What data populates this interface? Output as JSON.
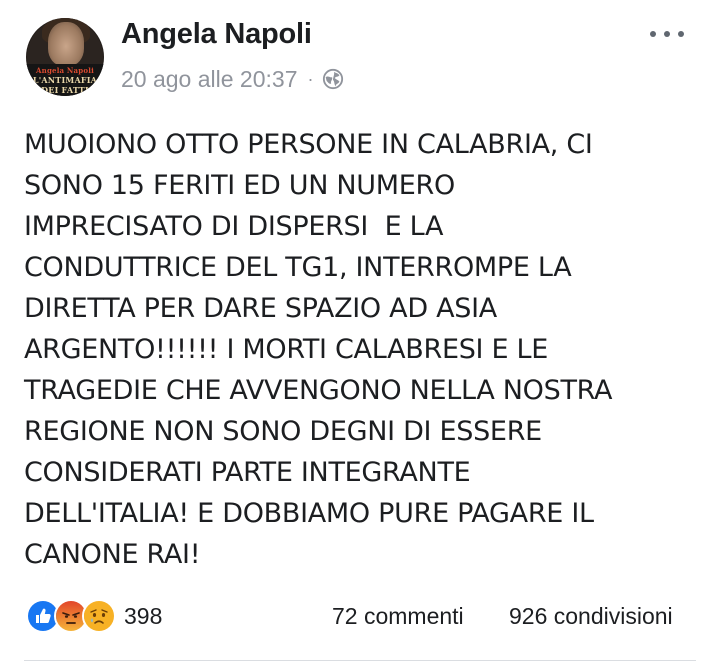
{
  "post": {
    "author": {
      "name": "Angela Napoli",
      "avatar_text": [
        "Angela Napoli",
        "L'ANTIMAFIA",
        "DEI FATTI"
      ]
    },
    "meta": {
      "timestamp": "20 ago alle 20:37",
      "separator": "·",
      "privacy_icon": "globe-icon"
    },
    "menu_icon": "more-horizontal-icon",
    "body_lines": [
      "MUOIONO OTTO PERSONE IN CALABRIA, CI",
      "SONO 15 FERITI ED UN NUMERO",
      "IMPRECISATO DI DISPERSI  E LA",
      "CONDUTTRICE DEL TG1, INTERROMPE LA",
      "DIRETTA PER DARE SPAZIO AD ASIA",
      "ARGENTO!!!!!! I MORTI CALABRESI E LE",
      "TRAGEDIE CHE AVVENGONO NELLA NOSTRA",
      "REGIONE NON SONO DEGNI DI ESSERE",
      "CONSIDERATI PARTE INTEGRANTE",
      "DELL'ITALIA! E DOBBIAMO PURE PAGARE IL",
      "CANONE RAI!"
    ],
    "reactions": {
      "icons": [
        "like-icon",
        "angry-icon",
        "sad-icon"
      ],
      "count": "398"
    },
    "comments": "72 commenti",
    "shares": "926 condivisioni"
  },
  "colors": {
    "text": "#1c1e21",
    "meta": "#90949c",
    "like": "#1877f2",
    "angry": "#e9710f",
    "sad": "#f7b125"
  }
}
